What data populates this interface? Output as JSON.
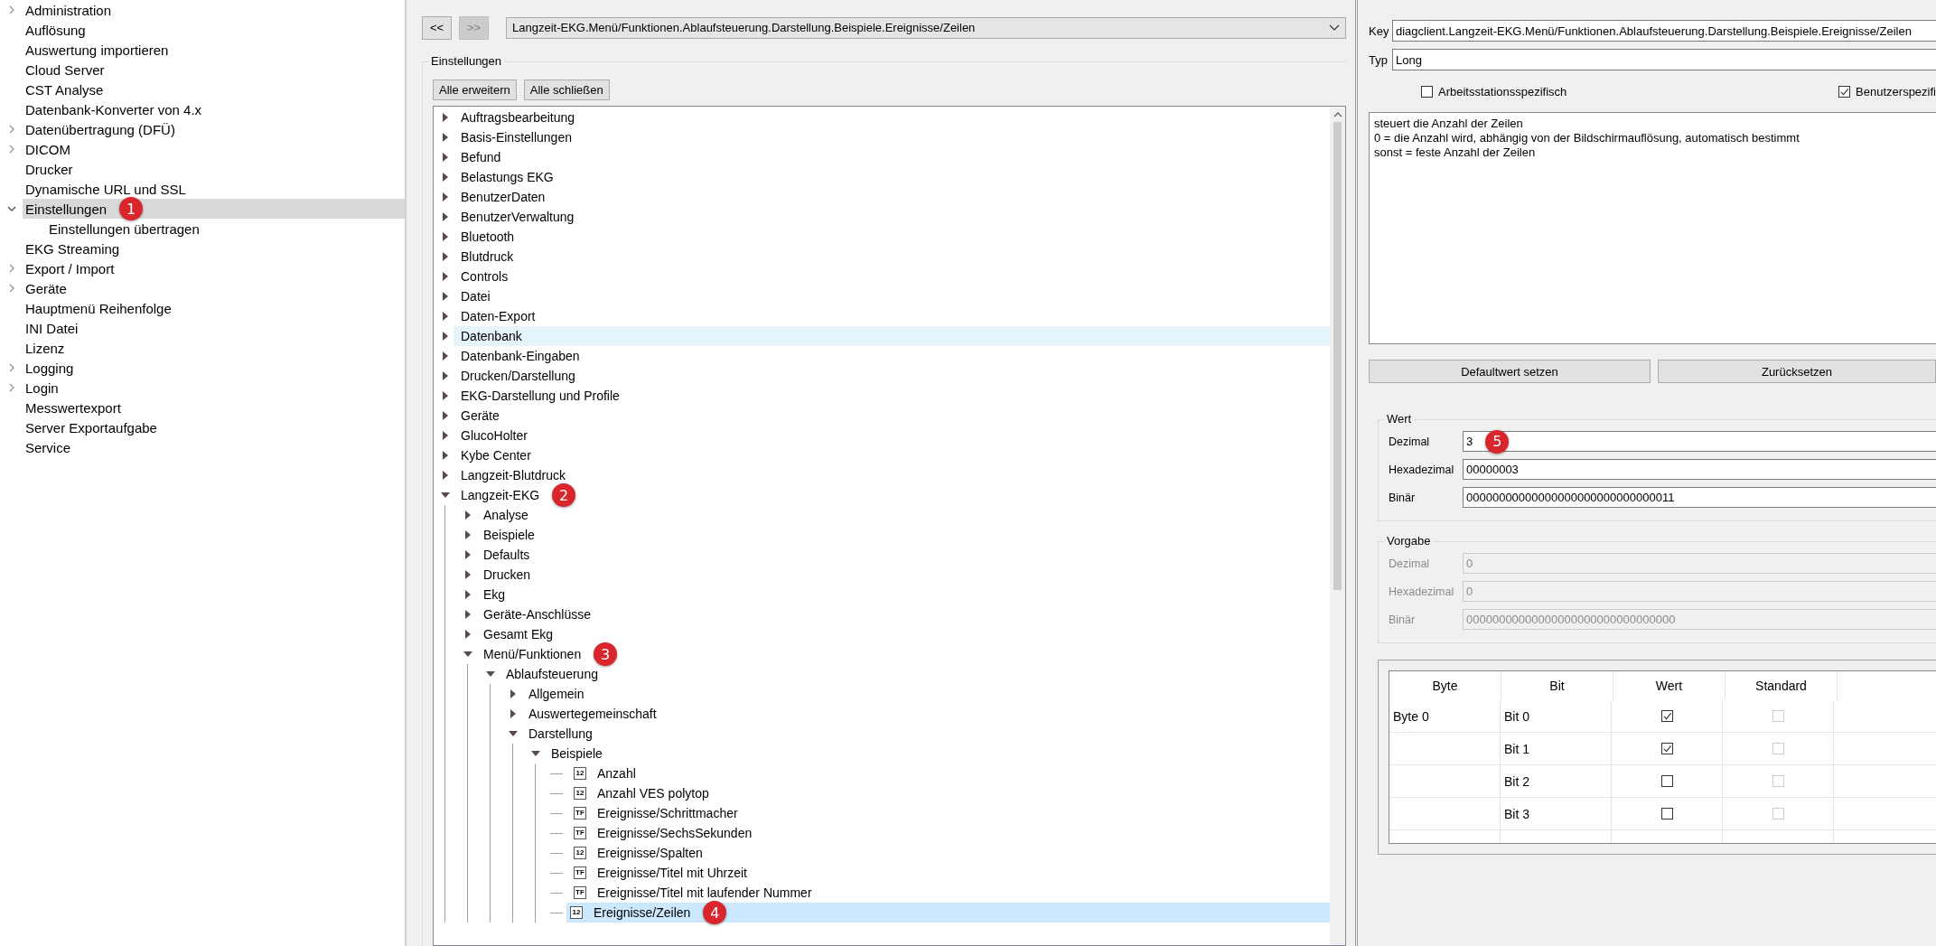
{
  "sidebar": {
    "items": [
      {
        "label": "Administration",
        "expanded": false,
        "selected": false
      },
      {
        "label": "Auflösung",
        "selected": false
      },
      {
        "label": "Auswertung importieren",
        "selected": false
      },
      {
        "label": "Cloud Server",
        "selected": false
      },
      {
        "label": "CST Analyse",
        "selected": false
      },
      {
        "label": "Datenbank-Konverter von 4.x",
        "selected": false
      },
      {
        "label": "Datenübertragung (DFÜ)",
        "expanded": false,
        "selected": false
      },
      {
        "label": "DICOM",
        "expanded": false,
        "selected": false
      },
      {
        "label": "Drucker",
        "selected": false
      },
      {
        "label": "Dynamische URL und SSL",
        "selected": false
      },
      {
        "label": "Einstellungen",
        "expanded": true,
        "selected": true,
        "badge": "1",
        "children": [
          {
            "label": "Einstellungen übertragen",
            "selected": false
          }
        ]
      },
      {
        "label": "EKG Streaming",
        "selected": false
      },
      {
        "label": "Export / Import",
        "expanded": false,
        "selected": false
      },
      {
        "label": "Geräte",
        "expanded": false,
        "selected": false
      },
      {
        "label": "Hauptmenü Reihenfolge",
        "selected": false
      },
      {
        "label": "INI Datei",
        "selected": false
      },
      {
        "label": "Lizenz",
        "selected": false
      },
      {
        "label": "Logging",
        "expanded": false,
        "selected": false
      },
      {
        "label": "Login",
        "expanded": false,
        "selected": false
      },
      {
        "label": "Messwertexport",
        "selected": false
      },
      {
        "label": "Server Exportaufgabe",
        "selected": false
      },
      {
        "label": "Service",
        "selected": false
      }
    ]
  },
  "navigation": {
    "back_button": {
      "label": "<<",
      "disabled": false
    },
    "forward_button": {
      "label": ">>",
      "disabled": true
    },
    "path": "Langzeit-EKG.Menü/Funktionen.Ablaufsteuerung.Darstellung.Beispiele.Ereignisse/Zeilen"
  },
  "settings": {
    "title": "Einstellungen",
    "buttons": [
      "Alle erweitern",
      "Alle schließen"
    ],
    "tree": [
      {
        "label": "Auftragsbearbeitung",
        "kind": "folder",
        "expanded": false,
        "selected": false,
        "hovered": false
      },
      {
        "label": "Basis-Einstellungen",
        "kind": "folder",
        "expanded": false,
        "selected": false,
        "hovered": false
      },
      {
        "label": "Befund",
        "kind": "folder",
        "expanded": false,
        "selected": false,
        "hovered": false
      },
      {
        "label": "Belastungs EKG",
        "kind": "folder",
        "expanded": false,
        "selected": false,
        "hovered": false
      },
      {
        "label": "BenutzerDaten",
        "kind": "folder",
        "expanded": false,
        "selected": false,
        "hovered": false
      },
      {
        "label": "BenutzerVerwaltung",
        "kind": "folder",
        "expanded": false,
        "selected": false,
        "hovered": false
      },
      {
        "label": "Bluetooth",
        "kind": "folder",
        "expanded": false,
        "selected": false,
        "hovered": false
      },
      {
        "label": "Blutdruck",
        "kind": "folder",
        "expanded": false,
        "selected": false,
        "hovered": false
      },
      {
        "label": "Controls",
        "kind": "folder",
        "expanded": false,
        "selected": false,
        "hovered": false
      },
      {
        "label": "Datei",
        "kind": "folder",
        "expanded": false,
        "selected": false,
        "hovered": false
      },
      {
        "label": "Daten-Export",
        "kind": "folder",
        "expanded": false,
        "selected": false,
        "hovered": false
      },
      {
        "label": "Datenbank",
        "kind": "folder",
        "expanded": false,
        "selected": false,
        "hovered": true
      },
      {
        "label": "Datenbank-Eingaben",
        "kind": "folder",
        "expanded": false,
        "selected": false,
        "hovered": false
      },
      {
        "label": "Drucken/Darstellung",
        "kind": "folder",
        "expanded": false,
        "selected": false,
        "hovered": false
      },
      {
        "label": "EKG-Darstellung und Profile",
        "kind": "folder",
        "expanded": false,
        "selected": false,
        "hovered": false
      },
      {
        "label": "Geräte",
        "kind": "folder",
        "expanded": false,
        "selected": false,
        "hovered": false
      },
      {
        "label": "GlucoHolter",
        "kind": "folder",
        "expanded": false,
        "selected": false,
        "hovered": false
      },
      {
        "label": "Kybe Center",
        "kind": "folder",
        "expanded": false,
        "selected": false,
        "hovered": false
      },
      {
        "label": "Langzeit-Blutdruck",
        "kind": "folder",
        "expanded": false,
        "selected": false,
        "hovered": false
      },
      {
        "label": "Langzeit-EKG",
        "kind": "folder",
        "expanded": true,
        "selected": false,
        "hovered": false,
        "badge": "2",
        "children": [
          {
            "label": "Analyse",
            "kind": "folder",
            "expanded": false,
            "selected": false
          },
          {
            "label": "Beispiele",
            "kind": "folder",
            "expanded": false,
            "selected": false
          },
          {
            "label": "Defaults",
            "kind": "folder",
            "expanded": false,
            "selected": false
          },
          {
            "label": "Drucken",
            "kind": "folder",
            "expanded": false,
            "selected": false
          },
          {
            "label": "Ekg",
            "kind": "folder",
            "expanded": false,
            "selected": false
          },
          {
            "label": "Geräte-Anschlüsse",
            "kind": "folder",
            "expanded": false,
            "selected": false
          },
          {
            "label": "Gesamt Ekg",
            "kind": "folder",
            "expanded": false,
            "selected": false
          },
          {
            "label": "Menü/Funktionen",
            "kind": "folder",
            "expanded": true,
            "selected": false,
            "badge": "3",
            "children": [
              {
                "label": "Ablaufsteuerung",
                "kind": "folder",
                "expanded": true,
                "selected": false,
                "children": [
                  {
                    "label": "Allgemein",
                    "kind": "folder",
                    "expanded": false,
                    "selected": false
                  },
                  {
                    "label": "Auswertegemeinschaft",
                    "kind": "folder",
                    "expanded": false,
                    "selected": false
                  },
                  {
                    "label": "Darstellung",
                    "kind": "folder",
                    "expanded": true,
                    "selected": false,
                    "children": [
                      {
                        "label": "Beispiele",
                        "kind": "folder",
                        "expanded": true,
                        "selected": false,
                        "children": [
                          {
                            "label": "Anzahl",
                            "kind": "leaf",
                            "type_icon": "12",
                            "selected": false
                          },
                          {
                            "label": "Anzahl VES polytop",
                            "kind": "leaf",
                            "type_icon": "12",
                            "selected": false
                          },
                          {
                            "label": "Ereignisse/Schrittmacher",
                            "kind": "leaf",
                            "type_icon": "TF",
                            "selected": false
                          },
                          {
                            "label": "Ereignisse/SechsSekunden",
                            "kind": "leaf",
                            "type_icon": "TF",
                            "selected": false
                          },
                          {
                            "label": "Ereignisse/Spalten",
                            "kind": "leaf",
                            "type_icon": "12",
                            "selected": false
                          },
                          {
                            "label": "Ereignisse/Titel mit Uhrzeit",
                            "kind": "leaf",
                            "type_icon": "TF",
                            "selected": false
                          },
                          {
                            "label": "Ereignisse/Titel mit laufender Nummer",
                            "kind": "leaf",
                            "type_icon": "TF",
                            "selected": false
                          },
                          {
                            "label": "Ereignisse/Zeilen",
                            "kind": "leaf",
                            "type_icon": "12",
                            "selected": true,
                            "badge": "4"
                          }
                        ]
                      }
                    ]
                  }
                ]
              }
            ]
          }
        ]
      }
    ]
  },
  "details": {
    "key_label": "Key",
    "key": "diagclient.Langzeit-EKG.Menü/Funktionen.Ablaufsteuerung.Darstellung.Beispiele.Ereignisse/Zeilen",
    "type_label": "Typ",
    "type": "Long",
    "checkboxes": [
      {
        "label": "Arbeitsstationsspezifisch",
        "checked": false
      },
      {
        "label": "Benutzerspezifi",
        "checked": true
      }
    ],
    "description": [
      "steuert die Anzahl der Zeilen",
      "0 = die Anzahl wird, abhängig von der Bildschirmauflösung, automatisch bestimmt",
      "sonst = feste Anzahl der Zeilen"
    ],
    "buttons": [
      "Defaultwert setzen",
      "Zurücksetzen"
    ]
  },
  "value_groups": [
    {
      "title": "Wert",
      "disabled": false,
      "fields": [
        {
          "label": "Dezimal",
          "value": "3",
          "badge": "5"
        },
        {
          "label": "Hexadezimal",
          "value": "00000003"
        },
        {
          "label": "Binär",
          "value": "00000000000000000000000000000011"
        }
      ]
    },
    {
      "title": "Vorgabe",
      "disabled": true,
      "fields": [
        {
          "label": "Dezimal",
          "value": "0"
        },
        {
          "label": "Hexadezimal",
          "value": "0"
        },
        {
          "label": "Binär",
          "value": "00000000000000000000000000000000"
        }
      ]
    }
  ],
  "bit_table": {
    "columns": [
      "Byte",
      "Bit",
      "Wert",
      "Standard"
    ],
    "rows": [
      {
        "byte": "Byte 0",
        "bit": "Bit 0",
        "value": true,
        "standard": false
      },
      {
        "bit": "Bit 1",
        "value": true,
        "standard": false
      },
      {
        "bit": "Bit 2",
        "value": false,
        "standard": false
      },
      {
        "bit": "Bit 3",
        "value": false,
        "standard": false
      }
    ]
  }
}
